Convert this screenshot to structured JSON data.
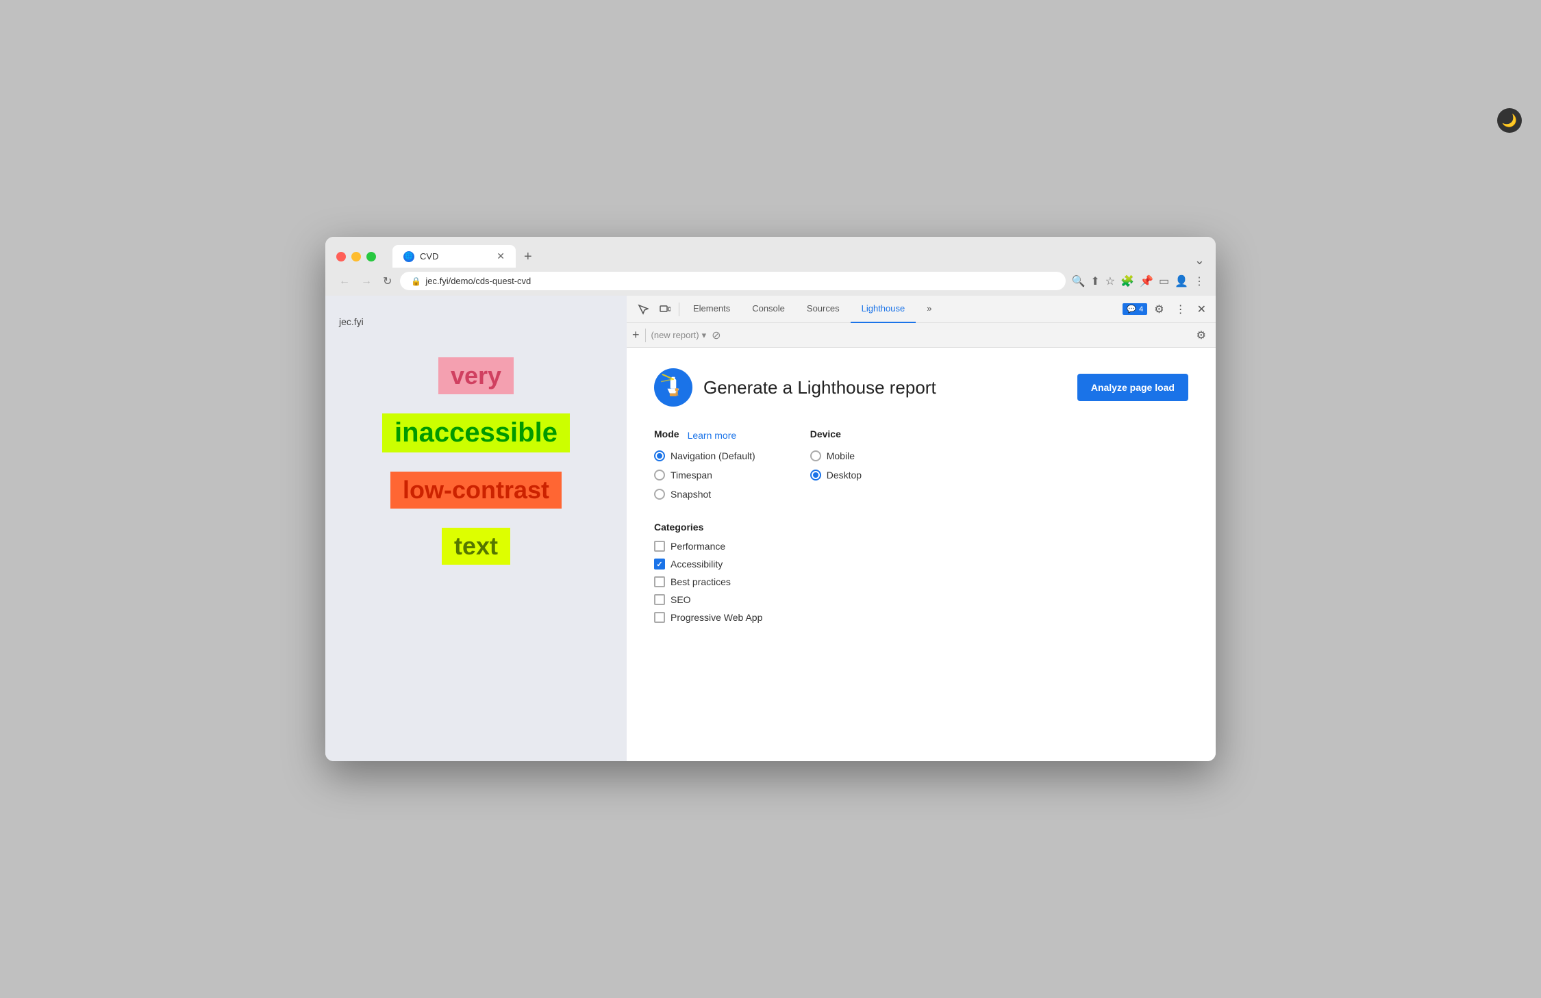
{
  "browser": {
    "tab_title": "CVD",
    "tab_favicon": "🌐",
    "url": "jec.fyi/demo/cds-quest-cvd",
    "new_tab_button": "+",
    "tab_dropdown": "⌄"
  },
  "nav": {
    "back_button": "←",
    "forward_button": "→",
    "refresh_button": "↻"
  },
  "webpage": {
    "site_label": "jec.fyi",
    "word_very": "very",
    "word_inaccessible": "inaccessible",
    "word_low_contrast": "low-contrast",
    "word_text": "text"
  },
  "devtools": {
    "tabs": {
      "elements": "Elements",
      "console": "Console",
      "sources": "Sources",
      "lighthouse": "Lighthouse",
      "more": "»"
    },
    "badge_icon": "💬",
    "badge_count": "4",
    "toolbar2": {
      "add_label": "+",
      "report_placeholder": "(new report)",
      "dropdown_arrow": "▾",
      "block_icon": "⊘",
      "settings_icon": "⚙"
    }
  },
  "lighthouse": {
    "title": "Generate a Lighthouse report",
    "analyze_button": "Analyze page load",
    "mode_label": "Mode",
    "learn_more_label": "Learn more",
    "mode_options": [
      {
        "id": "navigation",
        "label": "Navigation (Default)",
        "checked": true
      },
      {
        "id": "timespan",
        "label": "Timespan",
        "checked": false
      },
      {
        "id": "snapshot",
        "label": "Snapshot",
        "checked": false
      }
    ],
    "device_label": "Device",
    "device_options": [
      {
        "id": "mobile",
        "label": "Mobile",
        "checked": false
      },
      {
        "id": "desktop",
        "label": "Desktop",
        "checked": true
      }
    ],
    "categories_label": "Categories",
    "categories": [
      {
        "id": "performance",
        "label": "Performance",
        "checked": false
      },
      {
        "id": "accessibility",
        "label": "Accessibility",
        "checked": true
      },
      {
        "id": "best-practices",
        "label": "Best practices",
        "checked": false
      },
      {
        "id": "seo",
        "label": "SEO",
        "checked": false
      },
      {
        "id": "pwa",
        "label": "Progressive Web App",
        "checked": false
      }
    ]
  },
  "colors": {
    "blue_accent": "#1a73e8",
    "very_bg": "#f4a0b0",
    "very_text": "#d04060",
    "inaccessible_bg": "#ccff00",
    "inaccessible_text": "#009900",
    "low_contrast_bg": "#ff6633",
    "low_contrast_text": "#cc2200",
    "text_bg": "#ddff00",
    "text_text": "#557700"
  }
}
